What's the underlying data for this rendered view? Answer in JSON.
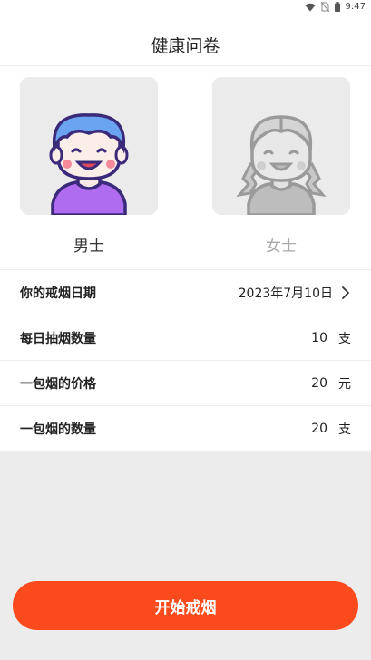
{
  "status_bar": {
    "time": "9:47"
  },
  "header": {
    "title": "健康问卷"
  },
  "gender": {
    "male_label": "男士",
    "female_label": "女士",
    "selected": "male"
  },
  "form": {
    "rows": [
      {
        "label": "你的戒烟日期",
        "value": "2023年7月10日",
        "unit": ""
      },
      {
        "label": "每日抽烟数量",
        "value": "10",
        "unit": "支"
      },
      {
        "label": "一包烟的价格",
        "value": "20",
        "unit": "元"
      },
      {
        "label": "一包烟的数量",
        "value": "20",
        "unit": "支"
      }
    ]
  },
  "actions": {
    "start_label": "开始戒烟"
  },
  "colors": {
    "accent": "#fb4a1c",
    "male_hair": "#6aa4f0",
    "male_shirt": "#b06cf0"
  }
}
